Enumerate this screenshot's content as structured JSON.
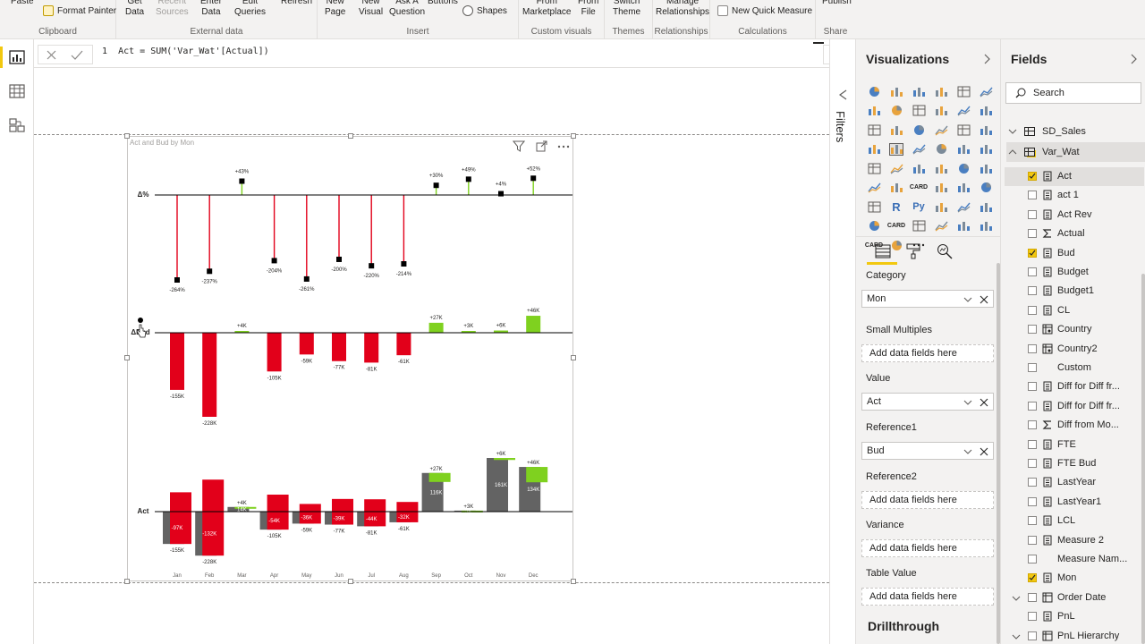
{
  "ribbon": {
    "groups": [
      {
        "name": "Clipboard",
        "buttons": [
          "Paste",
          "Format Painter"
        ]
      },
      {
        "name": "External data",
        "buttons": [
          "Get\nData",
          "Recent\nSources",
          "Enter\nData",
          "Edit\nQueries",
          "Refresh"
        ]
      },
      {
        "name": "Insert",
        "buttons": [
          "New\nPage",
          "New\nVisual",
          "Ask A\nQuestion",
          "Buttons",
          "Shapes"
        ]
      },
      {
        "name": "Custom visuals",
        "buttons": [
          "From\nMarketplace",
          "From\nFile"
        ]
      },
      {
        "name": "Themes",
        "buttons": [
          "Switch\nTheme"
        ]
      },
      {
        "name": "Relationships",
        "buttons": [
          "Manage\nRelationships"
        ]
      },
      {
        "name": "Calculations",
        "buttons": [
          "New Quick Measure"
        ]
      },
      {
        "name": "Share",
        "buttons": [
          "Publish"
        ]
      }
    ]
  },
  "formula": {
    "line": "1",
    "code": "Act = SUM('Var_Wat'[Actual])"
  },
  "filters_label": "Filters",
  "visual": {
    "title": "Act and Bud by Mon"
  },
  "chart_data": {
    "type": "bar",
    "categories": [
      "Jan",
      "Feb",
      "Mar",
      "Apr",
      "May",
      "Jun",
      "Jul",
      "Aug",
      "Sep",
      "Oct",
      "Nov",
      "Dec"
    ],
    "colors": {
      "negative": "#e2001a",
      "positive": "#7fd11f",
      "base": "#636363",
      "axis": "#000000"
    },
    "panels": [
      {
        "axis_label": "Δ%",
        "type": "pin",
        "labels": [
          "-264%",
          "-237%",
          "+43%",
          "-204%",
          "-261%",
          "-200%",
          "-220%",
          "-214%",
          "+30%",
          "+49%",
          "+4%",
          "+52%"
        ],
        "values": [
          -264,
          -237,
          43,
          -204,
          -261,
          -200,
          -220,
          -214,
          30,
          49,
          4,
          52
        ]
      },
      {
        "axis_label": "ΔBud",
        "type": "bar",
        "labels": [
          "-155K",
          "-228K",
          "+4K",
          "-105K",
          "-59K",
          "-77K",
          "-81K",
          "-61K",
          "+27K",
          "+3K",
          "+6K",
          "+46K"
        ],
        "values": [
          -155,
          -228,
          4,
          -105,
          -59,
          -77,
          -81,
          -61,
          27,
          3,
          6,
          46
        ]
      },
      {
        "axis_label": "Act",
        "type": "variance",
        "act": [
          -97,
          -132,
          14,
          -54,
          -36,
          -39,
          -44,
          -32,
          116,
          3,
          161,
          134
        ],
        "act_labels": [
          "-97K",
          "-132K",
          "14K",
          "-54K",
          "-36K",
          "-39K",
          "-44K",
          "-32K",
          "116K",
          "3K",
          "161K",
          "134K"
        ],
        "delta_labels": [
          "-155K",
          "-228K",
          "+4K",
          "-105K",
          "-59K",
          "-77K",
          "-81K",
          "-61K",
          "+27K",
          "+3K",
          "+6K",
          "+46K"
        ],
        "delta": [
          -155,
          -228,
          4,
          -105,
          -59,
          -77,
          -81,
          -61,
          27,
          3,
          6,
          46
        ]
      }
    ]
  },
  "viz_pane": {
    "title": "Visualizations",
    "wells": [
      {
        "label": "Category",
        "value": "Mon"
      },
      {
        "label": "Small Multiples",
        "value": "Add data fields here",
        "empty": true
      },
      {
        "label": "Value",
        "value": "Act"
      },
      {
        "label": "Reference1",
        "value": "Bud"
      },
      {
        "label": "Reference2",
        "value": "Add data fields here",
        "empty": true
      },
      {
        "label": "Variance",
        "value": "Add data fields here",
        "empty": true
      },
      {
        "label": "Table Value",
        "value": "Add data fields here",
        "empty": true
      }
    ],
    "drillthrough": "Drillthrough",
    "icons": [
      "CARD",
      "R",
      "Py",
      "CARD",
      "CARD"
    ]
  },
  "fields_pane": {
    "title": "Fields",
    "search_placeholder": "Search",
    "tables": [
      {
        "name": "SD_Sales",
        "expanded": false
      },
      {
        "name": "Var_Wat",
        "expanded": true
      }
    ],
    "fields": [
      {
        "name": "Act",
        "checked": true,
        "icon": "calc"
      },
      {
        "name": "act 1",
        "checked": false,
        "icon": "calc"
      },
      {
        "name": "Act Rev",
        "checked": false,
        "icon": "calc"
      },
      {
        "name": "Actual",
        "checked": false,
        "icon": "sigma"
      },
      {
        "name": "Bud",
        "checked": true,
        "icon": "calc"
      },
      {
        "name": "Budget",
        "checked": false,
        "icon": "calc"
      },
      {
        "name": "Budget1",
        "checked": false,
        "icon": "calc"
      },
      {
        "name": "CL",
        "checked": false,
        "icon": "calc"
      },
      {
        "name": "Country",
        "checked": false,
        "icon": "geo"
      },
      {
        "name": "Country2",
        "checked": false,
        "icon": "geo"
      },
      {
        "name": "Custom",
        "checked": false,
        "icon": "none"
      },
      {
        "name": "Diff for Diff fr...",
        "checked": false,
        "icon": "calc"
      },
      {
        "name": "Diff for Diff fr...",
        "checked": false,
        "icon": "calc"
      },
      {
        "name": "Diff from Mo...",
        "checked": false,
        "icon": "sigma"
      },
      {
        "name": "FTE",
        "checked": false,
        "icon": "calc"
      },
      {
        "name": "FTE Bud",
        "checked": false,
        "icon": "calc"
      },
      {
        "name": "LastYear",
        "checked": false,
        "icon": "calc"
      },
      {
        "name": "LastYear1",
        "checked": false,
        "icon": "calc"
      },
      {
        "name": "LCL",
        "checked": false,
        "icon": "calc"
      },
      {
        "name": "Measure 2",
        "checked": false,
        "icon": "calc"
      },
      {
        "name": "Measure Nam...",
        "checked": false,
        "icon": "none"
      },
      {
        "name": "Mon",
        "checked": true,
        "icon": "calc"
      },
      {
        "name": "Order Date",
        "checked": false,
        "icon": "table",
        "expand": true
      },
      {
        "name": "PnL",
        "checked": false,
        "icon": "calc"
      },
      {
        "name": "PnL Hierarchy",
        "checked": false,
        "icon": "table",
        "expand": true
      }
    ]
  }
}
